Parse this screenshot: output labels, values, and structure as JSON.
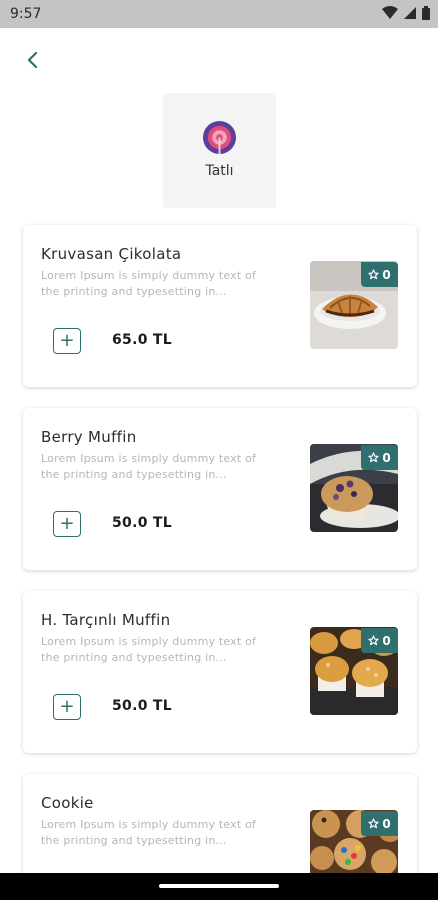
{
  "status_bar": {
    "time": "9:57"
  },
  "category": {
    "label": "Tatlı",
    "icon": "lollipop-icon"
  },
  "colors": {
    "accent": "#2f6f6d",
    "card_bg": "#ffffff",
    "tile_bg": "#f4f4f4",
    "muted_text": "#b6b6b6"
  },
  "products": [
    {
      "name": "Kruvasan Çikolata",
      "description": "Lorem Ipsum is simply dummy text of the printing and typesetting in...",
      "price": "65.0 TL",
      "favorites": "0",
      "image": "croissant"
    },
    {
      "name": "Berry Muffin",
      "description": "Lorem Ipsum is simply dummy text of the printing and typesetting in...",
      "price": "50.0 TL",
      "favorites": "0",
      "image": "berry-muffin"
    },
    {
      "name": "H. Tarçınlı Muffin",
      "description": "Lorem Ipsum is simply dummy text of the printing and typesetting in...",
      "price": "50.0 TL",
      "favorites": "0",
      "image": "cinnamon-muffin"
    },
    {
      "name": "Cookie",
      "description": "Lorem Ipsum is simply dummy text of the printing and typesetting in...",
      "price": "",
      "favorites": "0",
      "image": "cookie"
    }
  ]
}
